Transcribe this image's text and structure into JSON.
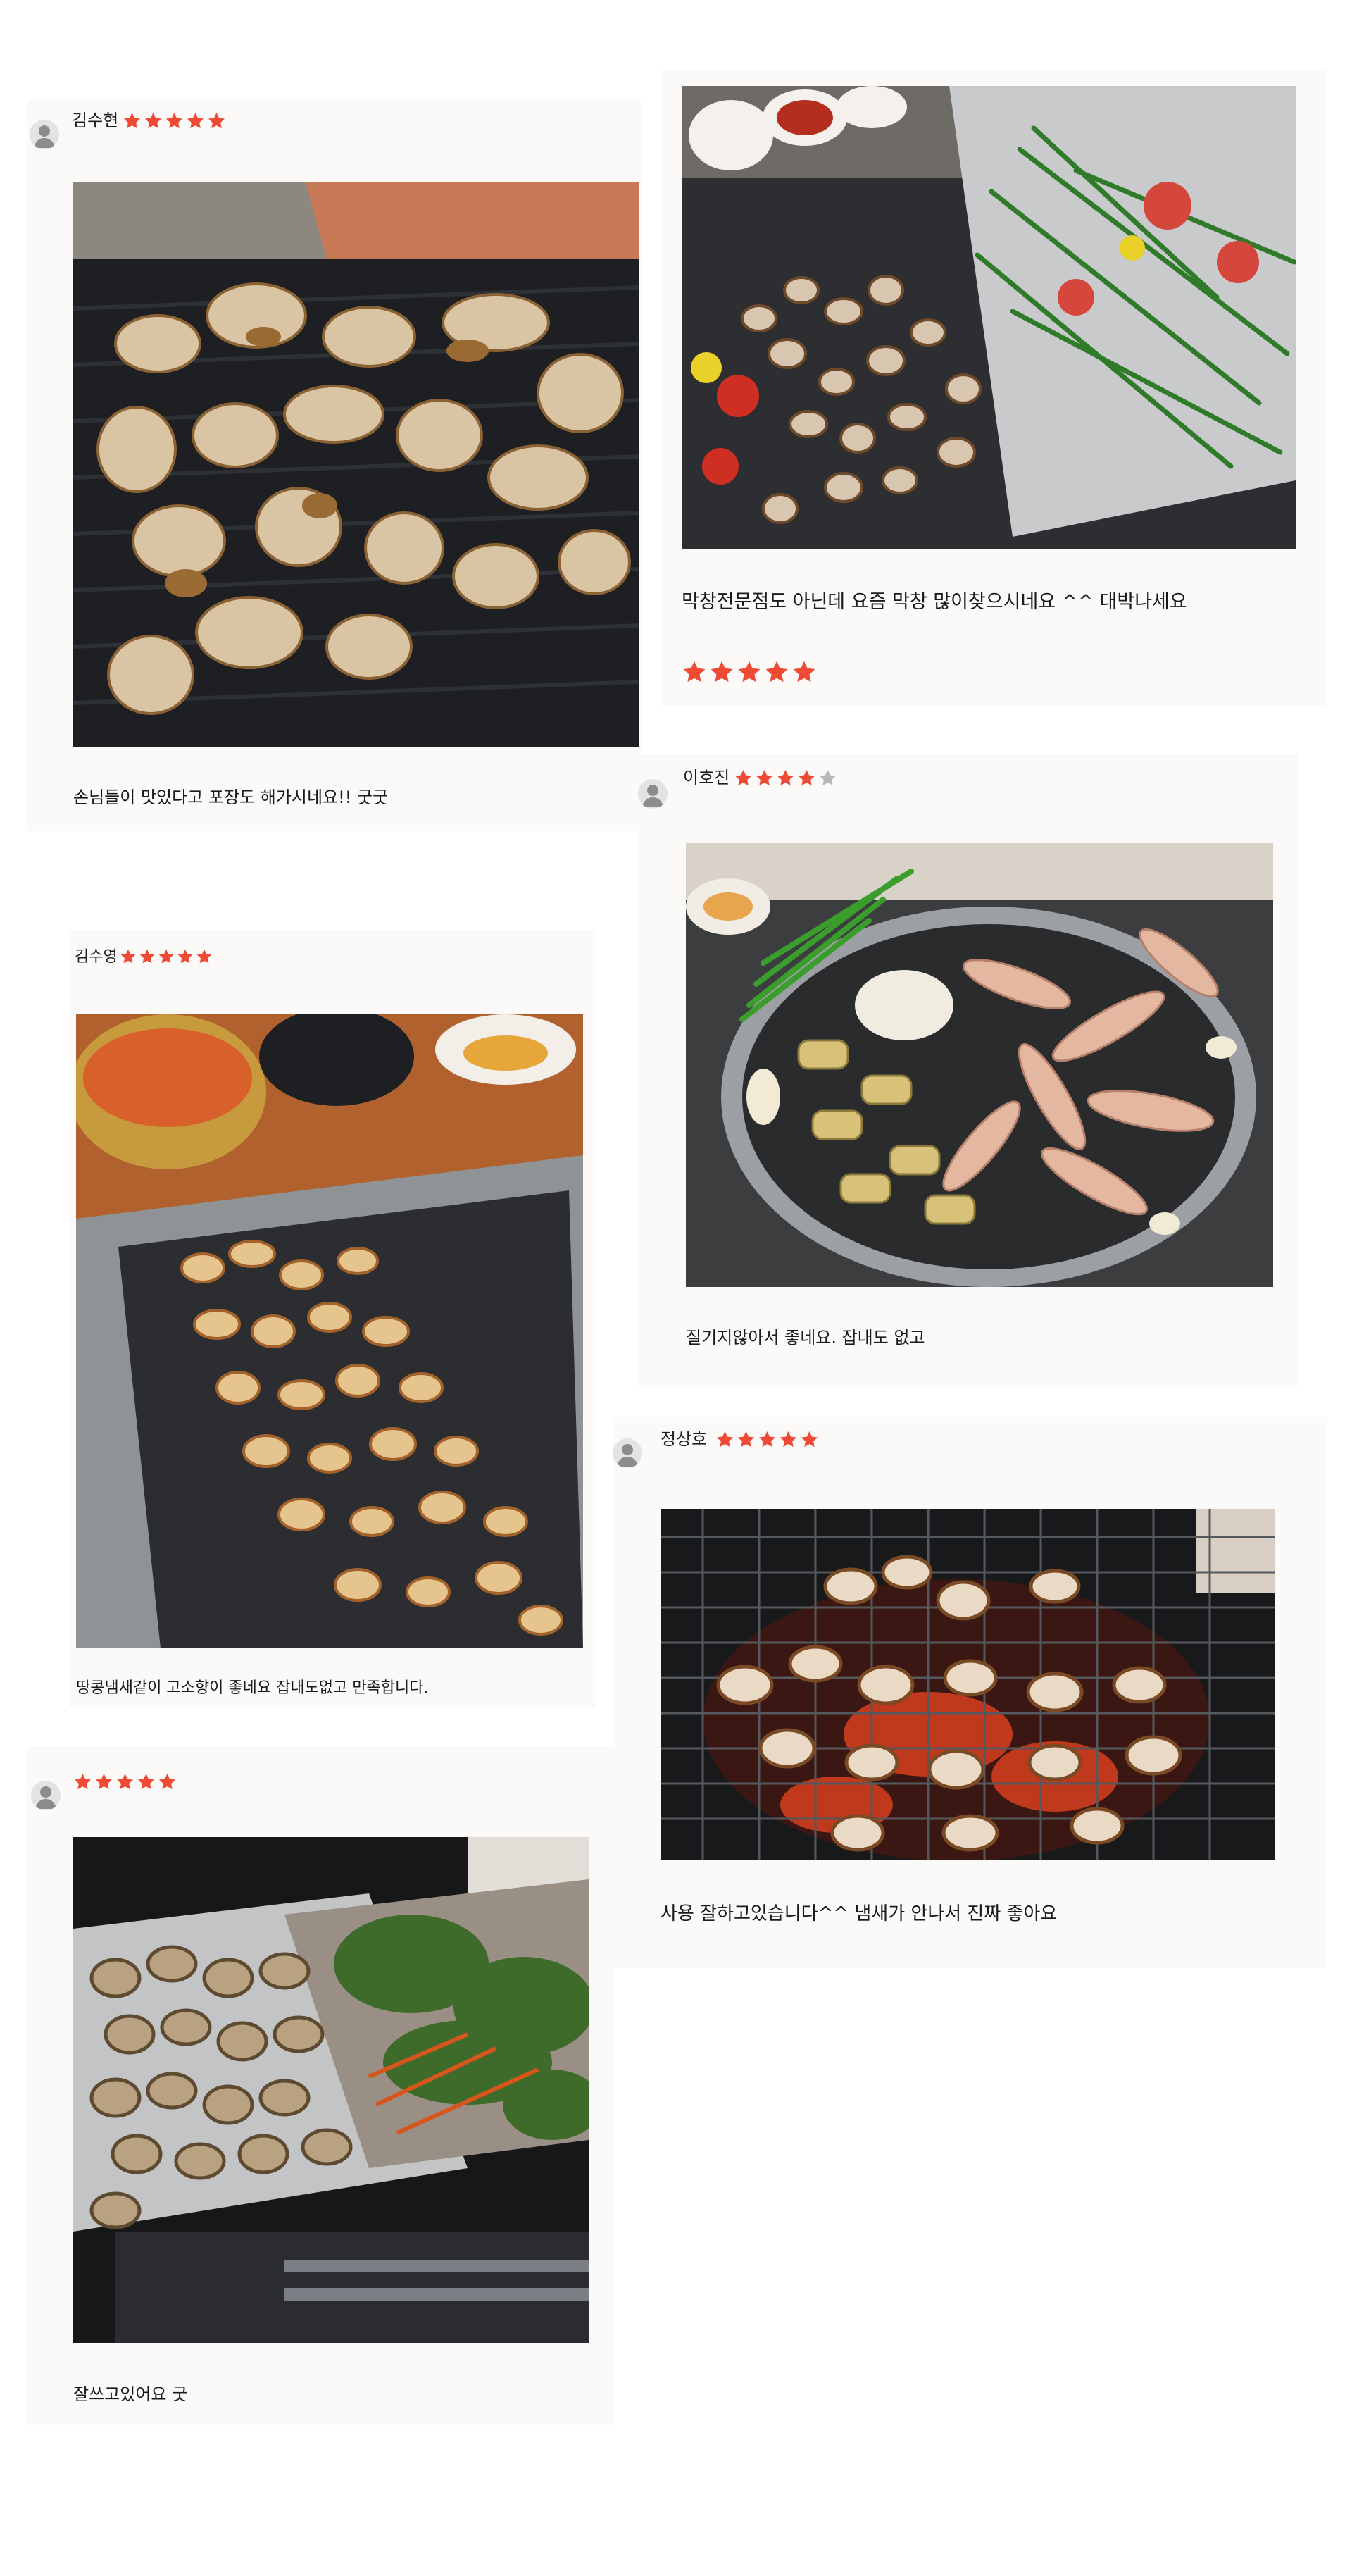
{
  "colors": {
    "star_on": "#ee4a36",
    "star_off": "#b8b8b8",
    "card_bg": "#fcfaf8"
  },
  "reviews": [
    {
      "author": "김수현",
      "stars": 5,
      "text": "손님들이 맛있다고 포장도 해가시네요!! 굿굿",
      "photo": "grilled-tripe-on-griddle"
    },
    {
      "author": "",
      "stars": 5,
      "text": "막창전문점도 아닌데 요즘 막창 많이찾으시네요 ^^ 대박나세요",
      "photo": "grilled-tripe-with-vegetables"
    },
    {
      "author": "이호진",
      "stars": 4,
      "text": "질기지않아서 좋네요. 잡내도 없고",
      "photo": "tripe-on-round-grill"
    },
    {
      "author": "김수영",
      "stars": 5,
      "text": "땅콩냄새같이 고소향이 좋네요 잡내도없고 만족합니다.",
      "photo": "tripe-on-table-grill"
    },
    {
      "author": "정상호",
      "stars": 5,
      "text": "사용 잘하고있습니다^^ 냄새가 안나서 진짜 좋아요",
      "photo": "tripe-on-charcoal-grill"
    },
    {
      "author": "",
      "stars": 5,
      "text": "잘쓰고있어요 굿",
      "photo": "tripe-on-foil-with-perilla"
    }
  ]
}
